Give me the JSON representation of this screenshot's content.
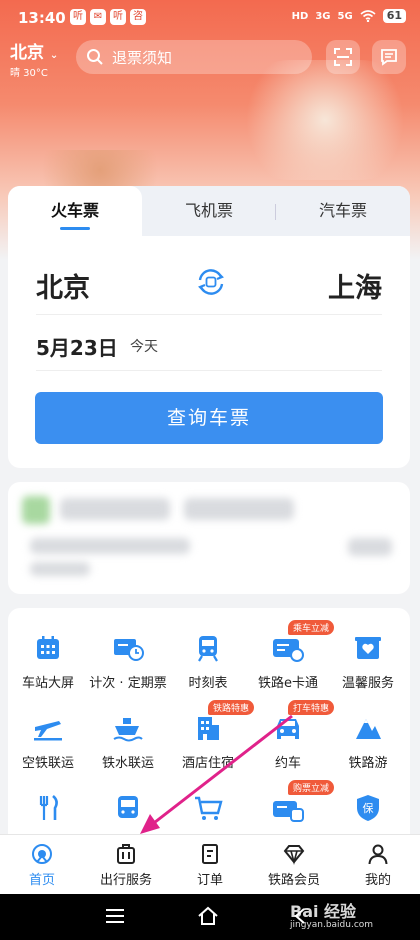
{
  "status_bar": {
    "time": "13:40",
    "app_icons": [
      "听",
      "",
      "听",
      "咨"
    ],
    "indicators": [
      "HD",
      "3G",
      "5G",
      "wifi"
    ],
    "battery": "61"
  },
  "header": {
    "city": "北京",
    "weather": "晴 30°C",
    "search_placeholder": "退票须知"
  },
  "ticket_tabs": [
    "火车票",
    "飞机票",
    "汽车票"
  ],
  "trip": {
    "from": "北京",
    "to": "上海",
    "date": "5月23日",
    "date_note": "今天",
    "query_label": "查询车票"
  },
  "services": [
    {
      "label": "车站大屏",
      "icon": "calendar-icon"
    },
    {
      "label": "计次 · 定期票",
      "icon": "ticket-clock-icon"
    },
    {
      "label": "时刻表",
      "icon": "train-icon"
    },
    {
      "label": "铁路e卡通",
      "icon": "card-icon",
      "badge": "乘车立减"
    },
    {
      "label": "温馨服务",
      "icon": "heart-box-icon"
    },
    {
      "label": "空铁联运",
      "icon": "plane-icon"
    },
    {
      "label": "铁水联运",
      "icon": "ship-icon"
    },
    {
      "label": "酒店住宿",
      "icon": "hotel-icon",
      "badge": "铁路特惠"
    },
    {
      "label": "约车",
      "icon": "car-icon",
      "badge": "打车特惠"
    },
    {
      "label": "铁路游",
      "icon": "mountain-icon"
    },
    {
      "label": "",
      "icon": "fork-knife-icon"
    },
    {
      "label": "",
      "icon": "bus-icon"
    },
    {
      "label": "",
      "icon": "cart-icon"
    },
    {
      "label": "",
      "icon": "card-train-icon",
      "badge": "购票立减"
    },
    {
      "label": "",
      "icon": "insurance-icon"
    }
  ],
  "bottom_nav": [
    {
      "label": "首页",
      "icon": "home-icon",
      "active": true
    },
    {
      "label": "出行服务",
      "icon": "suitcase-icon",
      "active": false
    },
    {
      "label": "订单",
      "icon": "order-icon",
      "active": false
    },
    {
      "label": "铁路会员",
      "icon": "diamond-icon",
      "active": false
    },
    {
      "label": "我的",
      "icon": "user-icon",
      "active": false
    }
  ],
  "watermark": {
    "brand": "Bai 经验",
    "site": "jingyan.baidu.com"
  },
  "colors": {
    "accent": "#2d8cf0",
    "button": "#3b8ff0",
    "badge": "#f05a3a",
    "annotation_arrow": "#e0228a"
  }
}
